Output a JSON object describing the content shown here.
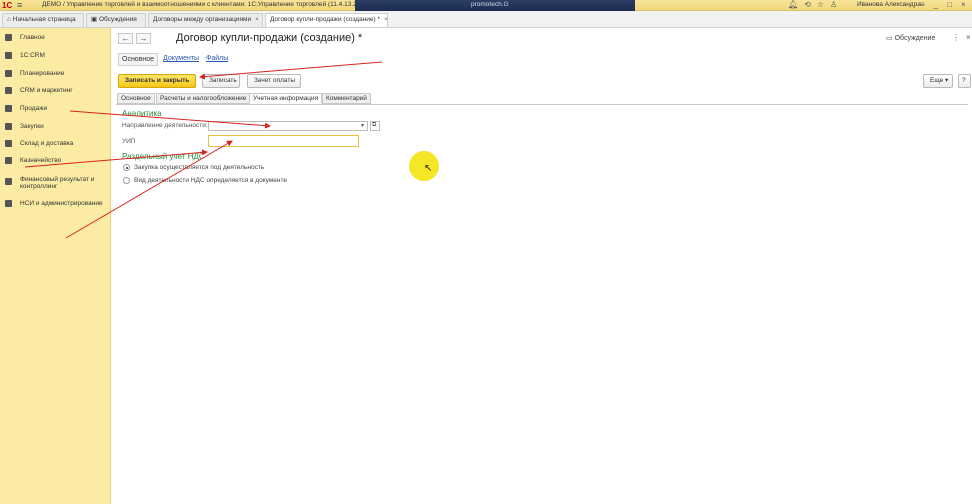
{
  "titlebar": {
    "logo": "1С",
    "title": "ДЕМО / Управление торговлей и взаимоотношениями с клиентами: 1С:Управление торговлей (11.4.13.2",
    "banner_text": "promotech.G",
    "user": "Иванова Александра"
  },
  "window_tabs": [
    {
      "label": "Начальная страница"
    },
    {
      "label": "Обсуждения"
    },
    {
      "label": "Договоры между организациями"
    },
    {
      "label": "Договор купли-продажи (создание) *"
    }
  ],
  "sidebar": {
    "items": [
      {
        "label": "Главное",
        "icon": "menu-icon"
      },
      {
        "label": "1С:CRM",
        "icon": "users-icon"
      },
      {
        "label": "Планирование",
        "icon": "chart-icon"
      },
      {
        "label": "CRM и маркетинг",
        "icon": "target-icon"
      },
      {
        "label": "Продажи",
        "icon": "bag-icon"
      },
      {
        "label": "Закупки",
        "icon": "cart-icon"
      },
      {
        "label": "Склад и доставка",
        "icon": "warehouse-icon"
      },
      {
        "label": "Казначейство",
        "icon": "coin-icon"
      },
      {
        "label": "Финансовый результат и контроллинг",
        "icon": "finance-icon"
      },
      {
        "label": "НСИ и администрирование",
        "icon": "gear-icon"
      }
    ]
  },
  "document": {
    "title": "Договор купли-продажи (создание) *",
    "discussion_label": "Обсуждение",
    "subtabs": [
      {
        "label": "Основное"
      },
      {
        "label": "Документы"
      },
      {
        "label": "Файлы"
      }
    ],
    "buttons": {
      "save_close": "Записать и закрыть",
      "save": "Записать",
      "invoice": "Зачет оплаты",
      "more": "Еще",
      "help": "?"
    },
    "form_tabs": [
      {
        "label": "Основное"
      },
      {
        "label": "Расчеты и налогообложение"
      },
      {
        "label": "Учетная информация"
      },
      {
        "label": "Комментарий"
      }
    ],
    "analytics": {
      "heading": "Аналитика",
      "direction_label": "Направление деятельности:",
      "direction_value": "",
      "uip_label": "УИП",
      "uip_value": ""
    },
    "vat": {
      "heading": "Раздельный учет НДС",
      "options": [
        {
          "label": "Закупка осуществляется под деятельность",
          "selected": true
        },
        {
          "label": "Вид деятельности НДС определяется в документе",
          "selected": false
        }
      ]
    }
  },
  "colors": {
    "sidebar_bg": "#fbeba3",
    "primary_button": "#f5c816",
    "section_heading": "#2a8a3e",
    "annotation_arrow": "#d9231f"
  }
}
